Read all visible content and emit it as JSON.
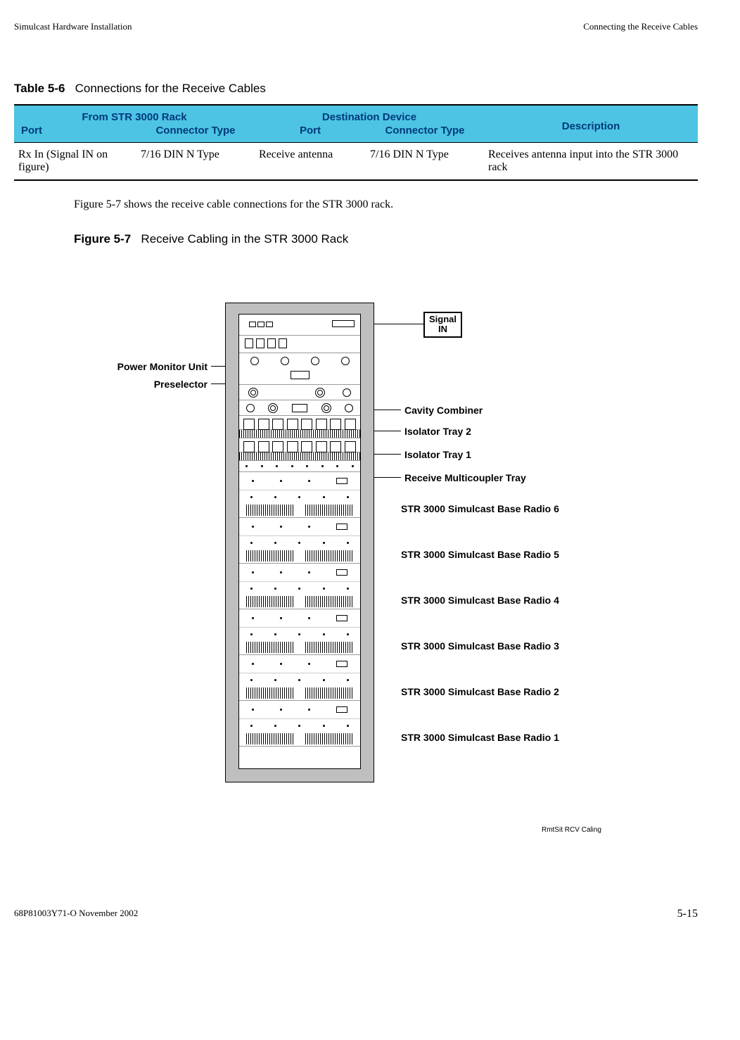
{
  "header": {
    "left": "Simulcast Hardware Installation",
    "right": "Connecting the Receive Cables"
  },
  "table_title": {
    "num": "Table 5-6",
    "text": "Connections for the Receive Cables"
  },
  "table": {
    "h1a": "From STR 3000 Rack",
    "h1b": "Destination Device",
    "h2a": "Port",
    "h2b": "Connector Type",
    "h2c": "Port",
    "h2d": "Connector Type",
    "h2e": "Description",
    "row1": {
      "c1": "Rx In (Signal IN on figure)",
      "c2": "7/16 DIN N Type",
      "c3": "Receive antenna",
      "c4": "7/16 DIN N Type",
      "c5": "Receives antenna input into the STR 3000 rack"
    }
  },
  "body_text": "Figure 5-7 shows the receive cable connections for the STR 3000 rack.",
  "figure_title": {
    "num": "Figure 5-7",
    "text": "Receive Cabling in the STR 3000 Rack"
  },
  "figure": {
    "signal_in": "Signal IN",
    "pmu": "Power Monitor Unit",
    "presel": "Preselector",
    "cavity": "Cavity Combiner",
    "iso2": "Isolator Tray 2",
    "iso1": "Isolator Tray 1",
    "rmc": "Receive Multicoupler Tray",
    "radio6": "STR 3000 Simulcast Base Radio 6",
    "radio5": "STR 3000 Simulcast Base Radio 5",
    "radio4": "STR 3000 Simulcast Base Radio 4",
    "radio3": "STR 3000 Simulcast Base Radio 3",
    "radio2": "STR 3000 Simulcast Base Radio 2",
    "radio1": "STR 3000 Simulcast Base Radio 1",
    "caption": "RmtSit RCV Caling"
  },
  "footer": {
    "left": "68P81003Y71-O    November 2002",
    "right": "5-15"
  }
}
